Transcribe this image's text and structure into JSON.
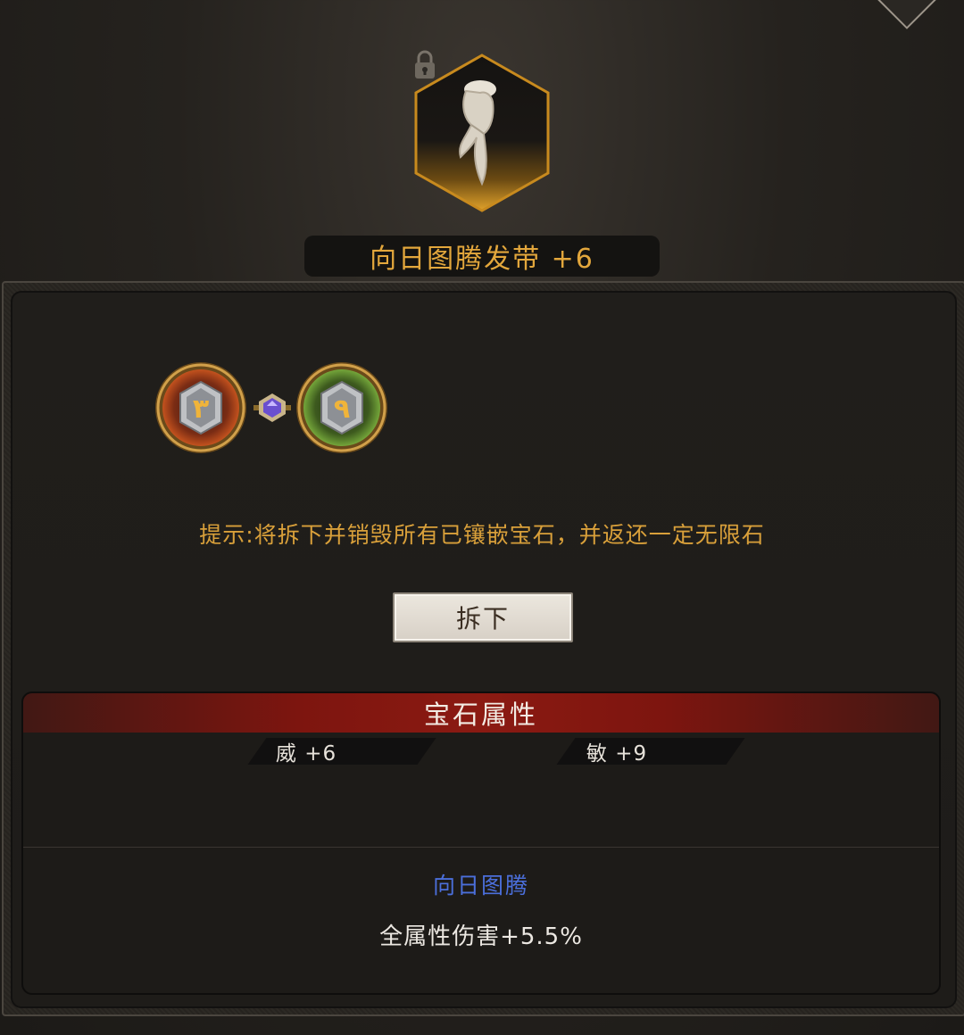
{
  "item": {
    "name": "向日图腾发带 +6",
    "icon": "headband-icon",
    "locked": true
  },
  "gems": [
    {
      "name": "ruby-gem-slot",
      "rune": "٣",
      "color": "#b34a20"
    },
    {
      "name": "emerald-gem-slot",
      "rune": "٩",
      "color": "#5c9a2e"
    }
  ],
  "hint": "提示:将拆下并销毁所有已镶嵌宝石，并返还一定无限石",
  "remove_button_label": "拆下",
  "gem_attributes": {
    "title": "宝石属性",
    "stats": [
      {
        "label": "威 +6"
      },
      {
        "label": "敏 +9"
      }
    ],
    "set_name": "向日图腾",
    "set_effect": "全属性伤害+5.5%"
  },
  "colors": {
    "accent_gold": "#e3a73c",
    "hint_gold": "#d9a03a",
    "header_red": "#8b1a12",
    "set_blue": "#4b6fdb"
  }
}
